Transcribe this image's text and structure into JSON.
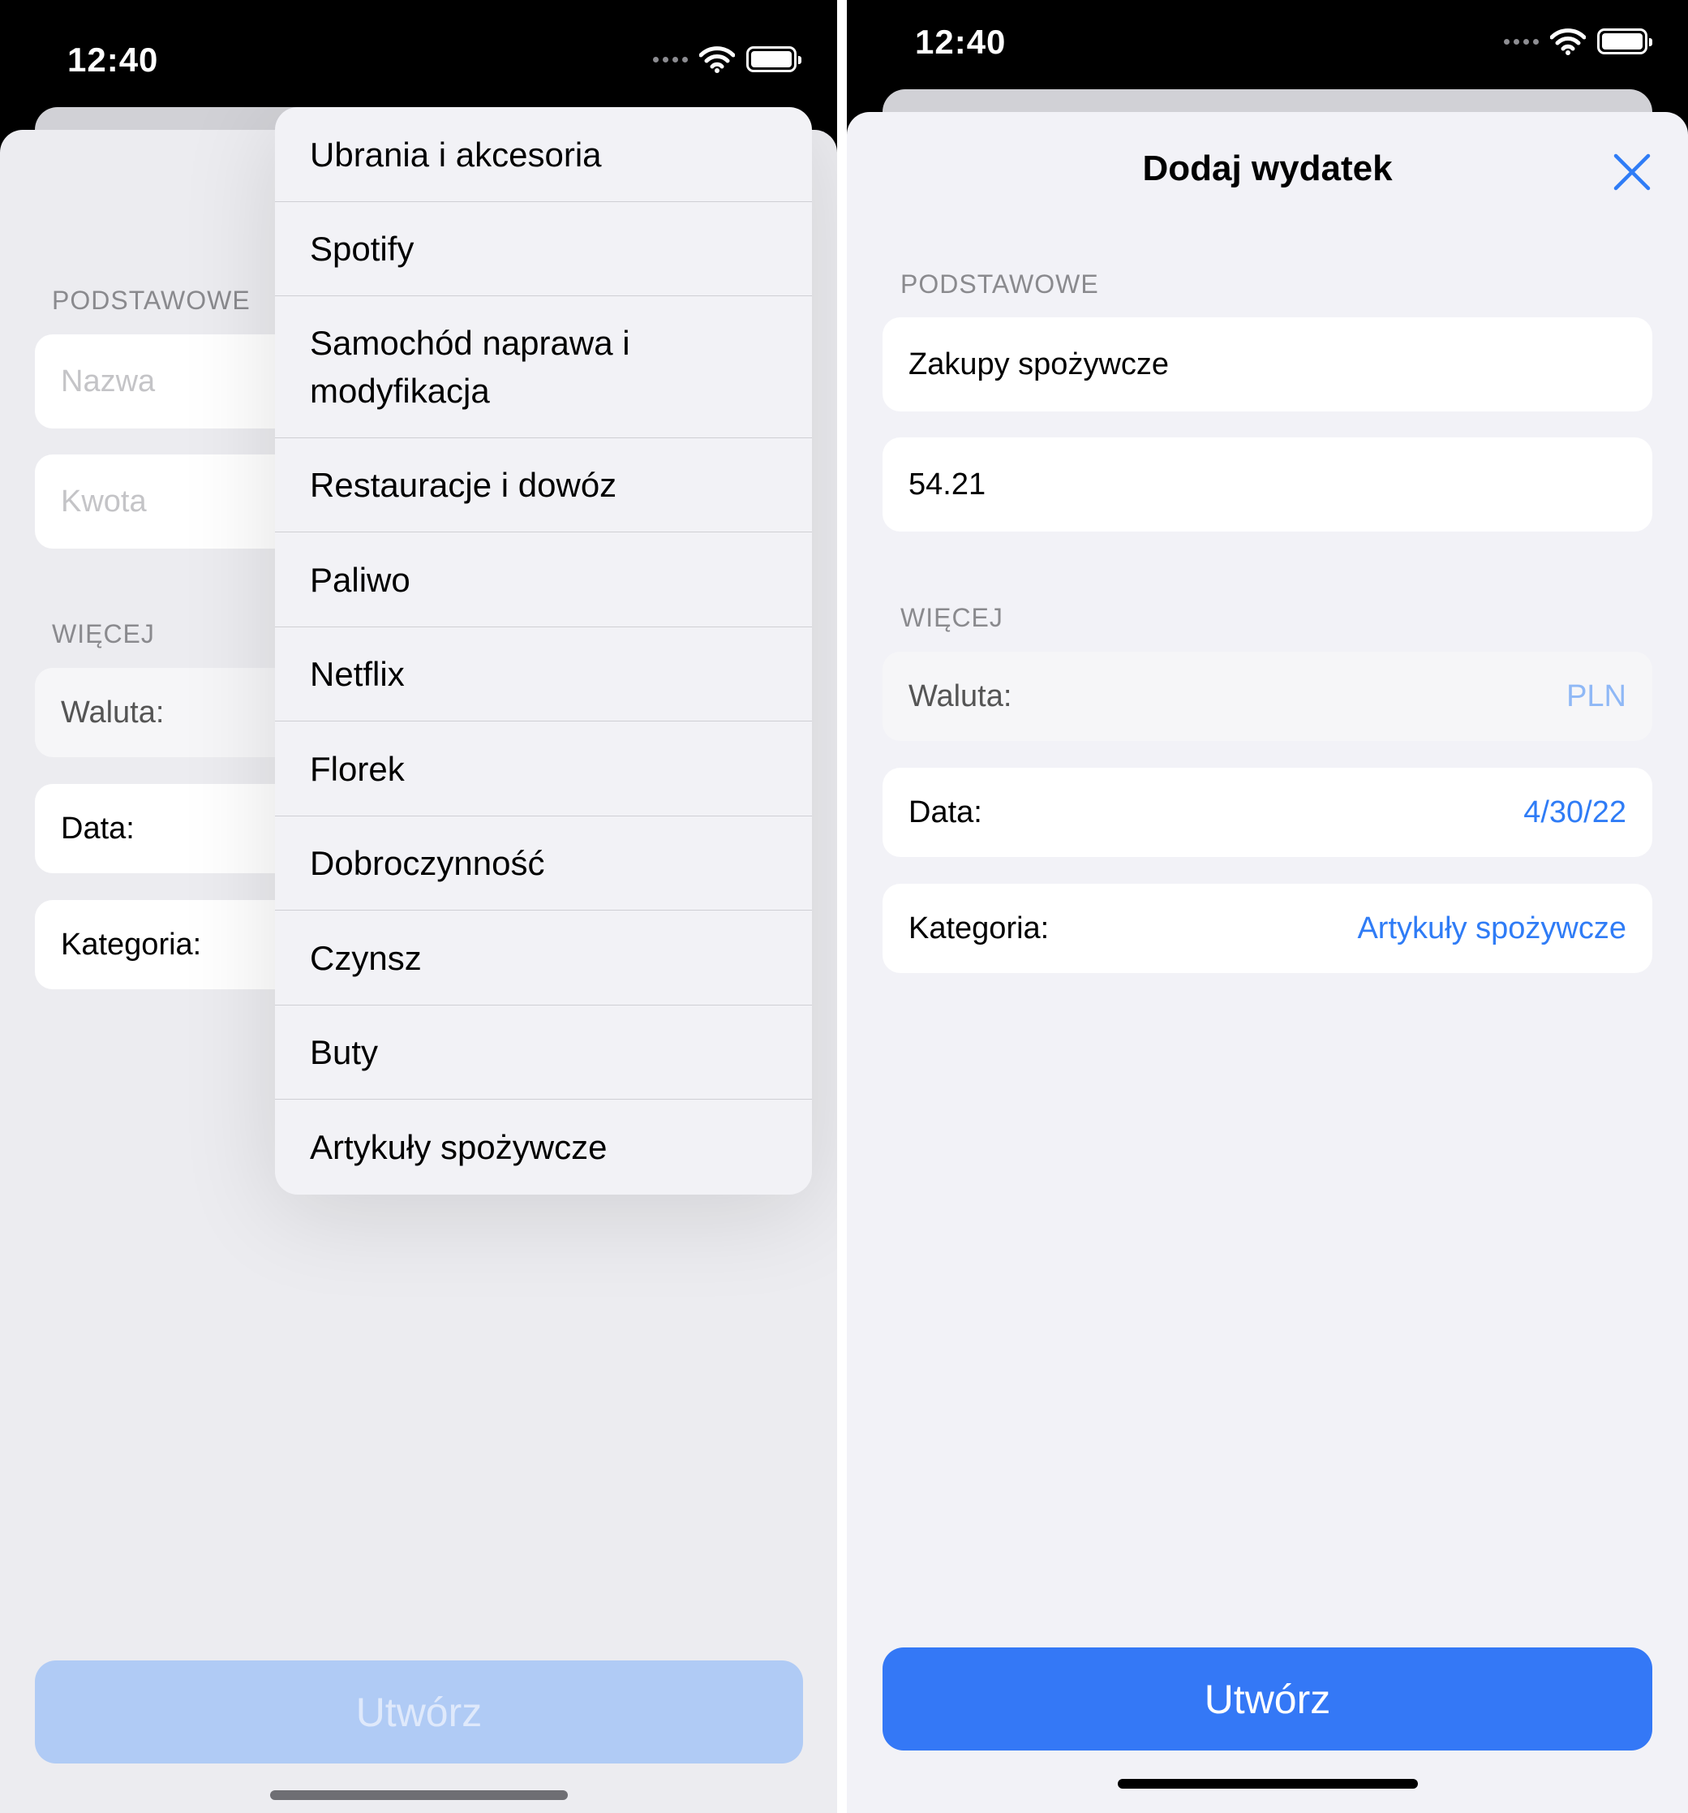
{
  "status_bar": {
    "time": "12:40"
  },
  "left_screen": {
    "sections": {
      "basic": "PODSTAWOWE",
      "more": "WIĘCEJ"
    },
    "fields": {
      "name_placeholder": "Nazwa",
      "amount_placeholder": "Kwota",
      "currency_label": "Waluta:",
      "date_label": "Data:",
      "category_label": "Kategoria:"
    },
    "category_menu": [
      "Ubrania i akcesoria",
      "Spotify",
      "Samochód naprawa i modyfikacja",
      "Restauracje i dowóz",
      "Paliwo",
      "Netflix",
      "Florek",
      "Dobroczynność",
      "Czynsz",
      "Buty",
      "Artykuły spożywcze"
    ],
    "create_label": "Utwórz"
  },
  "right_screen": {
    "title": "Dodaj wydatek",
    "sections": {
      "basic": "PODSTAWOWE",
      "more": "WIĘCEJ"
    },
    "fields": {
      "name_value": "Zakupy spożywcze",
      "amount_value": "54.21",
      "currency_label": "Waluta:",
      "currency_value": "PLN",
      "date_label": "Data:",
      "date_value": "4/30/22",
      "category_label": "Kategoria:",
      "category_value": "Artykuły spożywcze"
    },
    "create_label": "Utwórz"
  },
  "colors": {
    "accent": "#3478f6",
    "accent_disabled": "#b0cbf5",
    "background": "#f2f2f7",
    "status_bar": "#000000"
  }
}
